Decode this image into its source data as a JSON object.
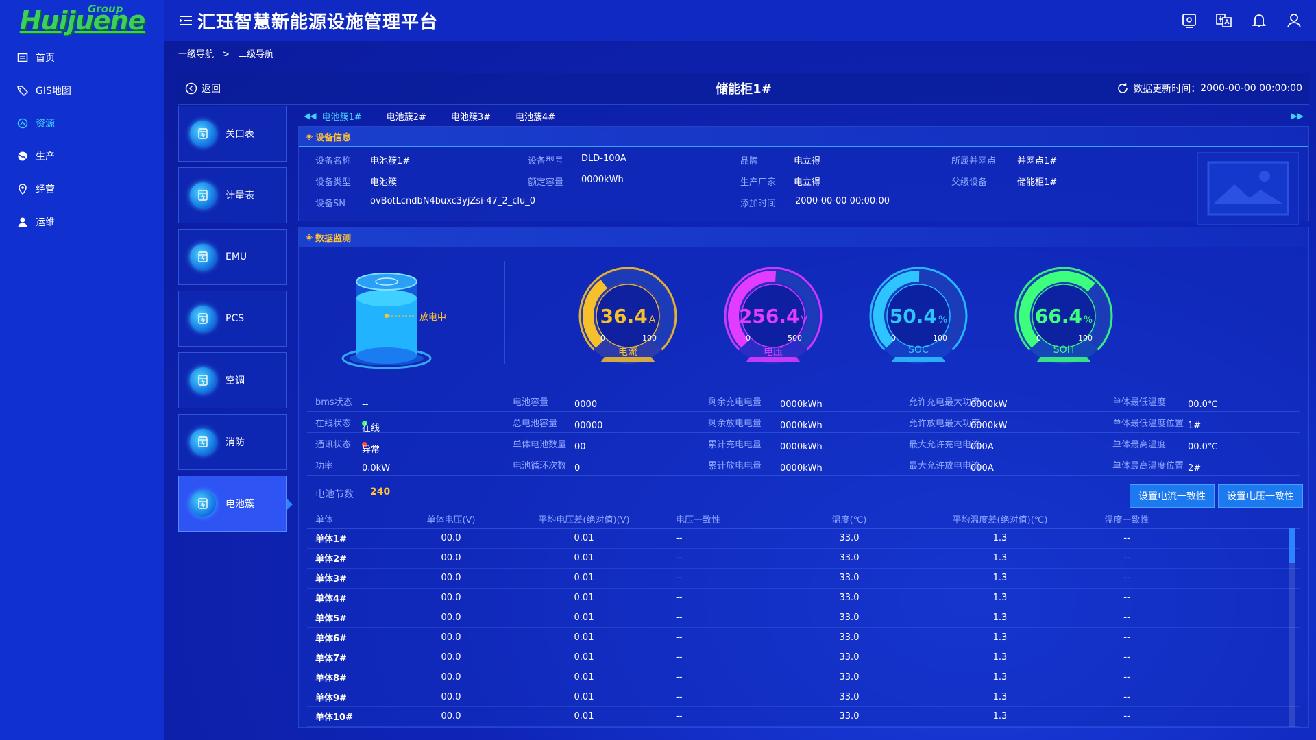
{
  "logo": {
    "text": "Huijuene",
    "sup": "Group"
  },
  "app_title": "汇珏智慧新能源设施管理平台",
  "nav": [
    {
      "label": "首页",
      "icon": "home-icon"
    },
    {
      "label": "GIS地图",
      "icon": "tag-icon"
    },
    {
      "label": "资源",
      "icon": "resource-icon",
      "active": true
    },
    {
      "label": "生产",
      "icon": "globe-icon"
    },
    {
      "label": "经营",
      "icon": "location-icon"
    },
    {
      "label": "运维",
      "icon": "user-icon"
    }
  ],
  "breadcrumb": [
    "一级导航",
    ">",
    "二级导航"
  ],
  "header": {
    "back": "返回",
    "title": "储能柜1#",
    "update_label": "数据更新时间：",
    "update_time": "2000-00-00 00:00:00"
  },
  "devices": [
    {
      "label": "关口表"
    },
    {
      "label": "计量表"
    },
    {
      "label": "EMU"
    },
    {
      "label": "PCS"
    },
    {
      "label": "空调"
    },
    {
      "label": "消防"
    },
    {
      "label": "电池簇",
      "active": true
    }
  ],
  "tabs": [
    "电池簇1#",
    "电池簇2#",
    "电池簇3#",
    "电池簇4#"
  ],
  "device_info": {
    "section_title": "设备信息",
    "name_label": "设备名称",
    "name": "电池簇1#",
    "model_label": "设备型号",
    "model": "DLD-100A",
    "brand_label": "品牌",
    "brand": "电立得",
    "grid_point_label": "所属并网点",
    "grid_point": "并网点1#",
    "type_label": "设备类型",
    "type": "电池簇",
    "capacity_label": "额定容量",
    "capacity": "0000kWh",
    "maker_label": "生产厂家",
    "maker": "电立得",
    "parent_label": "父级设备",
    "parent": "储能柜1#",
    "sn_label": "设备SN",
    "sn": "ovBotLcndbN4buxc3yjZsi-47_2_clu_0",
    "added_label": "添加时间",
    "added": "2000-00-00 00:00:00"
  },
  "monitor": {
    "section_title": "数据监测",
    "battery_state": "放电中",
    "gauges": [
      {
        "value": "36.4",
        "unit": "A",
        "min": "0",
        "max": "100",
        "label": "电流",
        "fraction": 0.364,
        "color": "#f5c02b"
      },
      {
        "value": "256.4",
        "unit": "V",
        "min": "0",
        "max": "500",
        "label": "电压",
        "fraction": 0.513,
        "color": "#e13cff"
      },
      {
        "value": "50.4",
        "unit": "%",
        "min": "0",
        "max": "100",
        "label": "SOC",
        "fraction": 0.504,
        "color": "#2ec4ff"
      },
      {
        "value": "66.4",
        "unit": "%",
        "min": "0",
        "max": "100",
        "label": "SOH",
        "fraction": 0.664,
        "color": "#3dff7e"
      }
    ],
    "stats": [
      [
        [
          "bms状态",
          "--"
        ],
        [
          "电池容量",
          "0000"
        ],
        [
          "剩余充电电量",
          "0000kWh"
        ],
        [
          "允许充电最大功率",
          "0000kW"
        ],
        [
          "单体最低温度",
          "00.0℃"
        ]
      ],
      [
        [
          "在线状态",
          "在线"
        ],
        [
          "总电池容量",
          "00000"
        ],
        [
          "剩余放电电量",
          "0000kWh"
        ],
        [
          "允许放电最大功率",
          "0000kW"
        ],
        [
          "单体最低温度位置",
          "1#"
        ]
      ],
      [
        [
          "通讯状态",
          "异常"
        ],
        [
          "单体电池数量",
          "00"
        ],
        [
          "累计充电电量",
          "0000kWh"
        ],
        [
          "最大允许充电电流",
          "000A"
        ],
        [
          "单体最高温度",
          "00.0℃"
        ]
      ],
      [
        [
          "功率",
          "0.0kW"
        ],
        [
          "电池循环次数",
          "0"
        ],
        [
          "累计放电电量",
          "0000kWh"
        ],
        [
          "最大允许放电电流",
          "000A"
        ],
        [
          "单体最高温度位置",
          "2#"
        ]
      ]
    ],
    "online_dot": "#3dff7e",
    "comm_dot": "#ff4d3a",
    "cell_count_label": "电池节数",
    "cell_count": "240",
    "btn_current": "设置电流一致性",
    "btn_voltage": "设置电压一致性"
  },
  "table": {
    "headers": [
      "单体",
      "单体电压(V)",
      "平均电压差(绝对值)(V)",
      "电压一致性",
      "温度(℃)",
      "平均温度差(绝对值)(℃)",
      "温度一致性"
    ],
    "rows": [
      [
        "单体1#",
        "00.0",
        "0.01",
        "--",
        "33.0",
        "1.3",
        "--"
      ],
      [
        "单体2#",
        "00.0",
        "0.01",
        "--",
        "33.0",
        "1.3",
        "--"
      ],
      [
        "单体3#",
        "00.0",
        "0.01",
        "--",
        "33.0",
        "1.3",
        "--"
      ],
      [
        "单体4#",
        "00.0",
        "0.01",
        "--",
        "33.0",
        "1.3",
        "--"
      ],
      [
        "单体5#",
        "00.0",
        "0.01",
        "--",
        "33.0",
        "1.3",
        "--"
      ],
      [
        "单体6#",
        "00.0",
        "0.01",
        "--",
        "33.0",
        "1.3",
        "--"
      ],
      [
        "单体7#",
        "00.0",
        "0.01",
        "--",
        "33.0",
        "1.3",
        "--"
      ],
      [
        "单体8#",
        "00.0",
        "0.01",
        "--",
        "33.0",
        "1.3",
        "--"
      ],
      [
        "单体9#",
        "00.0",
        "0.01",
        "--",
        "33.0",
        "1.3",
        "--"
      ],
      [
        "单体10#",
        "00.0",
        "0.01",
        "--",
        "33.0",
        "1.3",
        "--"
      ]
    ]
  }
}
